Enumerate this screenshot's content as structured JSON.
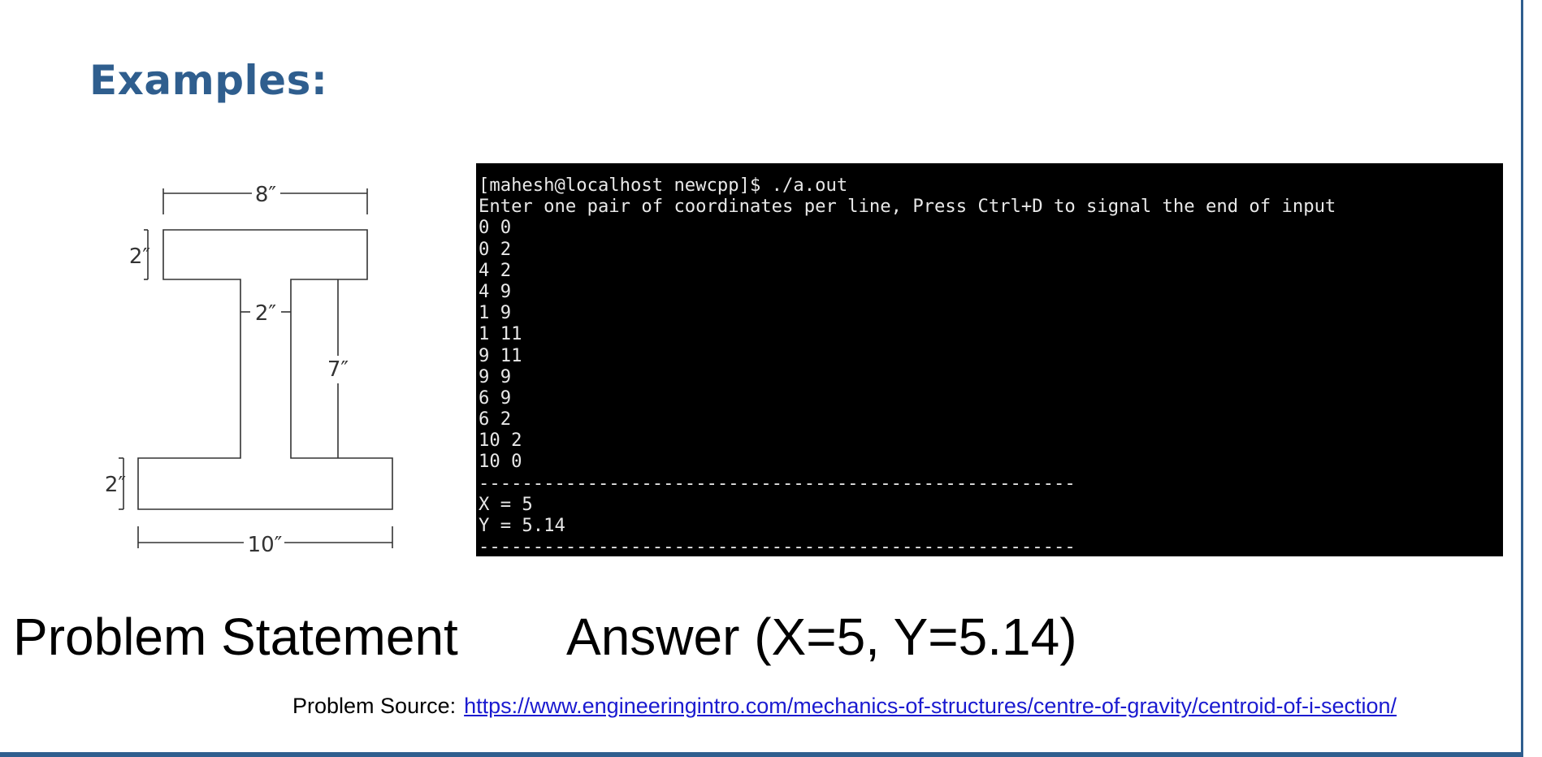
{
  "slide": {
    "heading": "Examples:",
    "problem_label": "Problem Statement",
    "answer_label": "Answer (X=5, Y=5.14)",
    "source_prefix": "Problem Source:",
    "source_url": "https://www.engineeringintro.com/mechanics-of-structures/centre-of-gravity/centroid-of-i-section/",
    "accent_color": "#2f5e8e"
  },
  "figure": {
    "top_width_label": "8″",
    "top_flange_thickness_label": "2″",
    "web_width_label": "2″",
    "web_height_label": "7″",
    "bottom_flange_thickness_label": "2″",
    "bottom_width_label": "10″"
  },
  "terminal": {
    "lines": [
      "[mahesh@localhost newcpp]$ ./a.out",
      "Enter one pair of coordinates per line, Press Ctrl+D to signal the end of input",
      "0 0",
      "0 2",
      "4 2",
      "4 9",
      "1 9",
      "1 11",
      "9 11",
      "9 9",
      "6 9",
      "6 2",
      "10 2",
      "10 0",
      "-------------------------------------------------------",
      "X = 5",
      "Y = 5.14",
      "-------------------------------------------------------"
    ]
  }
}
